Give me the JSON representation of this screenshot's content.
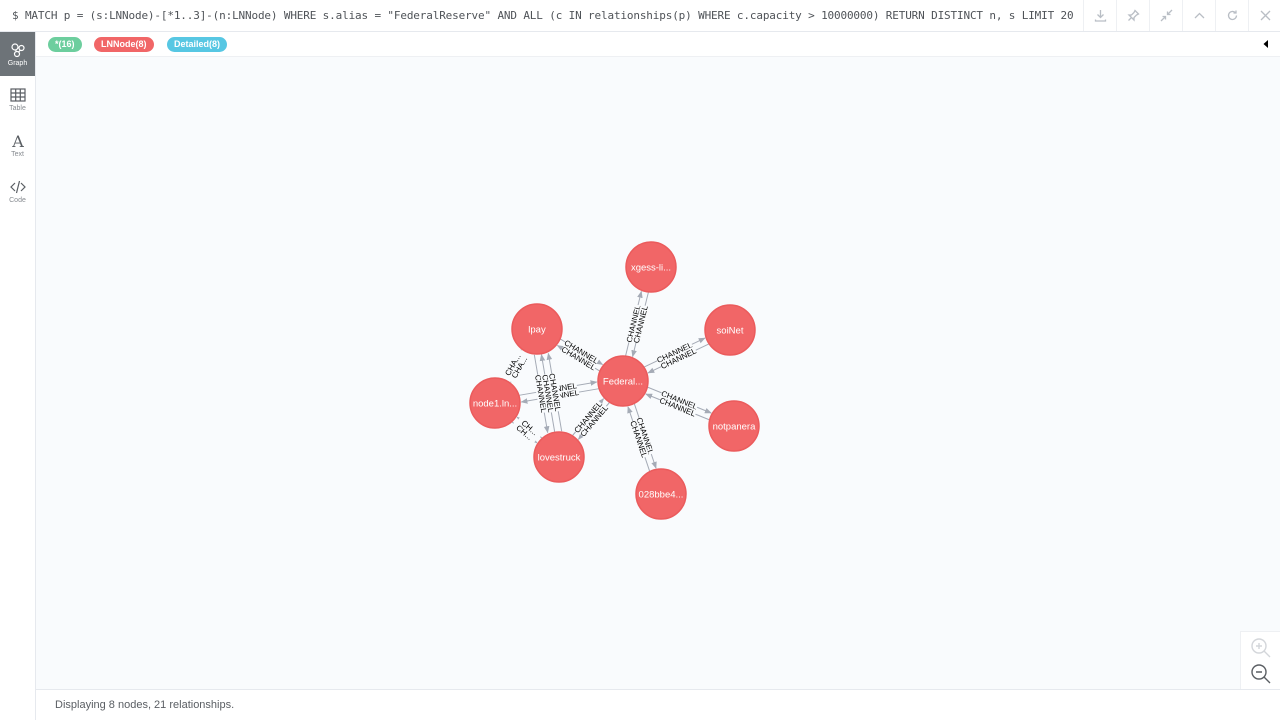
{
  "query": "$ MATCH p = (s:LNNode)-[*1..3]-(n:LNNode) WHERE s.alias = \"FederalReserve\" AND ALL (c IN relationships(p) WHERE c.capacity > 10000000) RETURN DISTINCT n, s LIMIT 20",
  "header_buttons": [
    {
      "name": "download-icon"
    },
    {
      "name": "pin-icon"
    },
    {
      "name": "collapse-arrows-icon"
    },
    {
      "name": "chevron-up-icon"
    },
    {
      "name": "rerun-icon"
    },
    {
      "name": "close-icon"
    }
  ],
  "sidebar": {
    "items": [
      {
        "label": "Graph",
        "icon": "graph-icon"
      },
      {
        "label": "Table",
        "icon": "table-icon"
      },
      {
        "label": "Text",
        "icon": "text-icon"
      },
      {
        "label": "Code",
        "icon": "code-icon"
      }
    ]
  },
  "tags": [
    {
      "label": "*(16)",
      "color": "#6dce9e"
    },
    {
      "label": "LNNode(8)",
      "color": "#f16667"
    },
    {
      "label": "Detailed(8)",
      "color": "#57c7e3"
    }
  ],
  "colors": {
    "node_fill": "#f16667",
    "node_stroke": "#eb5b5c",
    "edge": "#a5abb6",
    "edge_text": "#000000"
  },
  "graph": {
    "nodes": [
      {
        "id": "fed",
        "label": "Federal..."
      },
      {
        "id": "xgess",
        "label": "xgess-li..."
      },
      {
        "id": "soinet",
        "label": "soiNet"
      },
      {
        "id": "notpanera",
        "label": "notpanera"
      },
      {
        "id": "n028",
        "label": "028bbe4..."
      },
      {
        "id": "lovestruck",
        "label": "lovestruck"
      },
      {
        "id": "node1",
        "label": "node1.ln..."
      },
      {
        "id": "lpay",
        "label": "lpay"
      }
    ],
    "edges": [
      {
        "from": "fed",
        "to": "xgess",
        "label": "CHANNEL"
      },
      {
        "from": "xgess",
        "to": "fed",
        "label": "CHANNEL"
      },
      {
        "from": "fed",
        "to": "soinet",
        "label": "CHANNEL"
      },
      {
        "from": "soinet",
        "to": "fed",
        "label": "CHANNEL"
      },
      {
        "from": "fed",
        "to": "notpanera",
        "label": "CHANNEL"
      },
      {
        "from": "notpanera",
        "to": "fed",
        "label": "CHANNEL"
      },
      {
        "from": "fed",
        "to": "n028",
        "label": "CHANNEL"
      },
      {
        "from": "n028",
        "to": "fed",
        "label": "CHANNEL"
      },
      {
        "from": "fed",
        "to": "lovestruck",
        "label": "CHANNEL"
      },
      {
        "from": "lovestruck",
        "to": "fed",
        "label": "CHANNEL"
      },
      {
        "from": "fed",
        "to": "node1",
        "label": "CHANNEL"
      },
      {
        "from": "node1",
        "to": "fed",
        "label": "CHANNEL"
      },
      {
        "from": "fed",
        "to": "lpay",
        "label": "CHANNEL"
      },
      {
        "from": "lpay",
        "to": "fed",
        "label": "CHANNEL"
      },
      {
        "from": "lpay",
        "to": "node1",
        "label": "CHA..."
      },
      {
        "from": "node1",
        "to": "lpay",
        "label": "CHA..."
      },
      {
        "from": "lpay",
        "to": "lovestruck",
        "label": "CHANNEL"
      },
      {
        "from": "lovestruck",
        "to": "lpay",
        "label": "CHANNEL"
      },
      {
        "from": "node1",
        "to": "lovestruck",
        "label": "CH..."
      },
      {
        "from": "lovestruck",
        "to": "node1",
        "label": "CH..."
      },
      {
        "from": "lovestruck",
        "to": "lpay",
        "label": "CHANNEL"
      }
    ]
  },
  "zoom": [
    {
      "name": "zoom-in-icon"
    },
    {
      "name": "zoom-out-icon"
    }
  ],
  "status_text": "Displaying 8 nodes, 21 relationships."
}
